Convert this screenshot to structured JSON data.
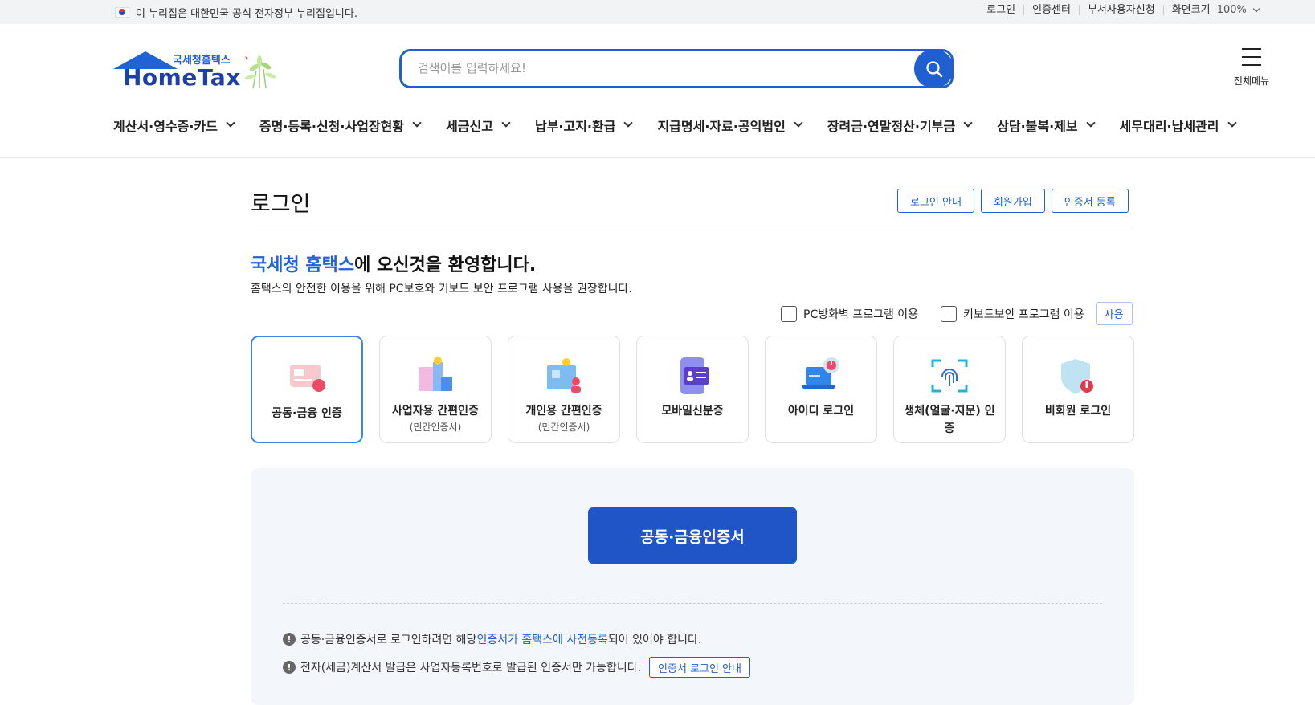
{
  "gov_banner": {
    "text": "이 누리집은 대한민국 공식 전자정부 누리집입니다.",
    "links": [
      "로그인",
      "인증센터",
      "부서사용자신청"
    ],
    "zoom_label": "화면크기",
    "zoom_value": "100%"
  },
  "logo": {
    "sub": "국세청홈택스",
    "main": "HomeTax"
  },
  "search": {
    "placeholder": "검색어를 입력하세요!"
  },
  "all_menu": {
    "label": "전체메뉴"
  },
  "gnb": [
    "계산서·영수증·카드",
    "증명·등록·신청·사업장현황",
    "세금신고",
    "납부·고지·환급",
    "지급명세·자료·공익법인",
    "장려금·연말정산·기부금",
    "상담·불복·제보",
    "세무대리·납세관리"
  ],
  "page": {
    "title": "로그인",
    "buttons": [
      "로그인 안내",
      "회원가입",
      "인증서 등록"
    ],
    "welcome_highlight": "국세청 홈택스",
    "welcome_rest": "에 오신것을 환영합니다.",
    "welcome_sub": "홈택스의 안전한 이용을 위해 PC보호와 키보드 보안 프로그램 사용을 권장합니다.",
    "options": [
      "PC방화벽 프로그램 이용",
      "키보드보안 프로그램 이용"
    ],
    "use_label": "사용"
  },
  "login_cards": [
    {
      "label": "공동·금융 인증",
      "sub": ""
    },
    {
      "label": "사업자용 간편인증",
      "sub": "(민간인증서)"
    },
    {
      "label": "개인용 간편인증",
      "sub": "(민간인증서)"
    },
    {
      "label": "모바일신분증",
      "sub": ""
    },
    {
      "label": "아이디 로그인",
      "sub": ""
    },
    {
      "label": "생체(얼굴·지문) 인증",
      "sub": ""
    },
    {
      "label": "비회원 로그인",
      "sub": ""
    }
  ],
  "panel": {
    "cert_button": "공동·금융인증서",
    "note1_pre": "공동·금융인증서로 로그인하려면 해당 ",
    "note1_link": "인증서가 홈택스에 사전등록",
    "note1_post": "되어 있어야 합니다.",
    "note2": "전자(세금)계산서 발급은 사업자등록번호로 발급된 인증서만 가능합니다.",
    "note2_button": "인증서 로그인 안내"
  },
  "colors": {
    "primary": "#1f5fd0",
    "brand_dark": "#1d3fa8",
    "panel_bg": "#f3f6fa"
  }
}
